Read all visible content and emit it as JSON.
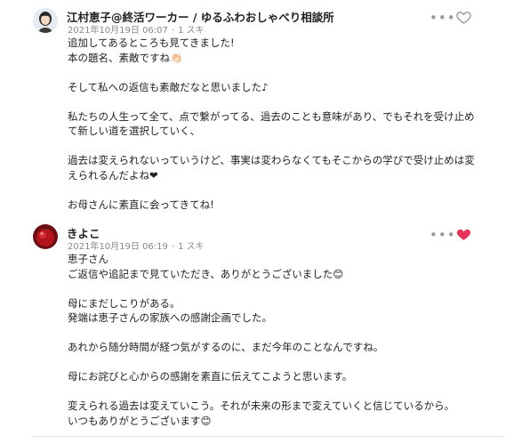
{
  "comments": [
    {
      "author": "江村恵子@終活ワーカー / ゆるふわおしゃべり相談所",
      "date": "2021年10月19日 06:07",
      "likes": "1 スキ",
      "liked": false,
      "paragraphs": [
        [
          "追加してあるところも見てきました!",
          "本の題名、素敵ですね👏🏻"
        ],
        [
          "そして私への返信も素敵だなと思いました♪"
        ],
        [
          "私たちの人生って全て、点で繋がってる、過去のことも意味があり、でもそれを受け止め",
          "て新しい道を選択していく、"
        ],
        [
          "過去は変えられないっていうけど、事実は変わらなくてもそこからの学びで受け止めは変",
          "えられるんだよね❤"
        ],
        [
          "お母さんに素直に会ってきてね!"
        ]
      ]
    },
    {
      "author": "きよこ",
      "date": "2021年10月19日 06:19",
      "likes": "1 スキ",
      "liked": true,
      "paragraphs": [
        [
          "恵子さん",
          "ご返信や追記まで見ていただき、ありがとうございました😊"
        ],
        [
          "母にまだしこりがある。",
          "発端は恵子さんの家族への感謝企画でした。"
        ],
        [
          "あれから随分時間が経つ気がするのに、まだ今年のことなんですね。"
        ],
        [
          "母にお詫びと心からの感謝を素直に伝えてこようと思います。"
        ],
        [
          "変えられる過去は変えていこう。それが未来の形まで変えていくと信じているから。",
          "いつもありがとうございます😊"
        ]
      ]
    }
  ],
  "icons": {
    "menu": "more-dots-icon",
    "like_off": "heart-outline-icon",
    "like_on": "heart-filled-icon",
    "clock_bullet": "dot"
  },
  "colors": {
    "heart_active": "#e5335a",
    "heart_inactive": "#999999",
    "meta": "#888888"
  }
}
